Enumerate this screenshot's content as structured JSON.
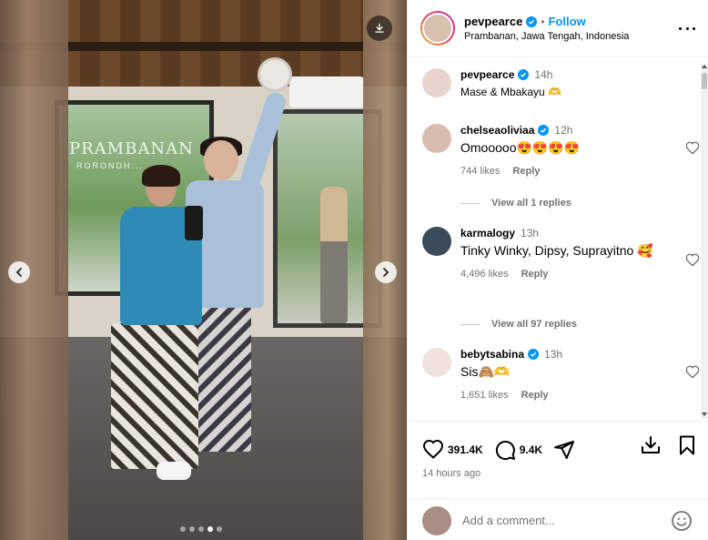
{
  "post": {
    "username": "pevpearce",
    "follow_label": "Follow",
    "separator": "•",
    "location": "Prambanan, Jawa Tengah, Indonesia",
    "sign_text": "PRAMBANAN",
    "sign_sub": "RORONDH..."
  },
  "comments": [
    {
      "user": "pevpearce",
      "time": "14h",
      "text": "Mase & Mbakayu 🫶",
      "avatar_color": "#e8d6cc"
    },
    {
      "user": "chelseaoliviaa",
      "time": "12h",
      "text": "Omooooo😍😍😍😍",
      "likes": "744 likes",
      "reply": "Reply",
      "view_replies": "View all 1 replies",
      "avatar_color": "#d9bcb0"
    },
    {
      "user": "karmalogy",
      "time": "13h",
      "text": "Tinky Winky, Dipsy, Suprayitno 🥰",
      "likes": "4,496 likes",
      "reply": "Reply",
      "view_replies": "View all 97 replies",
      "avatar_color": "#3c4b5a"
    },
    {
      "user": "bebytsabina",
      "time": "13h",
      "text": "Sis🙈🫶",
      "likes": "1,651 likes",
      "reply": "Reply",
      "avatar_color": "#f0e2dc"
    }
  ],
  "stats": {
    "likes": "391.4K",
    "comments": "9.4K",
    "posted": "14 hours ago"
  },
  "composer": {
    "placeholder": "Add a comment..."
  },
  "carousel": {
    "total": 5,
    "active_index": 3
  },
  "colors": {
    "accent": "#0095f6",
    "muted": "#737373"
  }
}
